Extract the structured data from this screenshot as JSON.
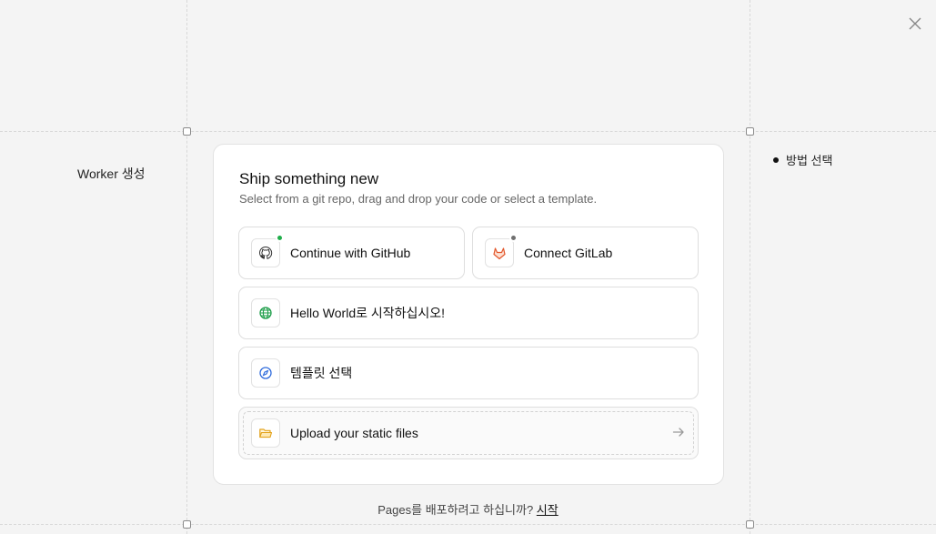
{
  "close": {
    "icon": "close-icon"
  },
  "side_label": "Worker 생성",
  "steps": [
    {
      "label": "방법 선택"
    }
  ],
  "card": {
    "title": "Ship something new",
    "subtitle": "Select from a git repo, drag and drop your code or select a template."
  },
  "options": {
    "github": {
      "label": "Continue with GitHub",
      "icon": "github-icon",
      "status_color": "#1fae4a"
    },
    "gitlab": {
      "label": "Connect GitLab",
      "icon": "gitlab-icon",
      "status_color": "#707070"
    },
    "hello": {
      "label": "Hello World로 시작하십시오!",
      "icon": "globe-icon"
    },
    "template": {
      "label": "템플릿 선택",
      "icon": "compass-icon"
    },
    "upload": {
      "label": "Upload your static files",
      "icon": "folder-icon"
    }
  },
  "footer": {
    "text": "Pages를 배포하려고 하십니까? ",
    "link": "시작"
  }
}
